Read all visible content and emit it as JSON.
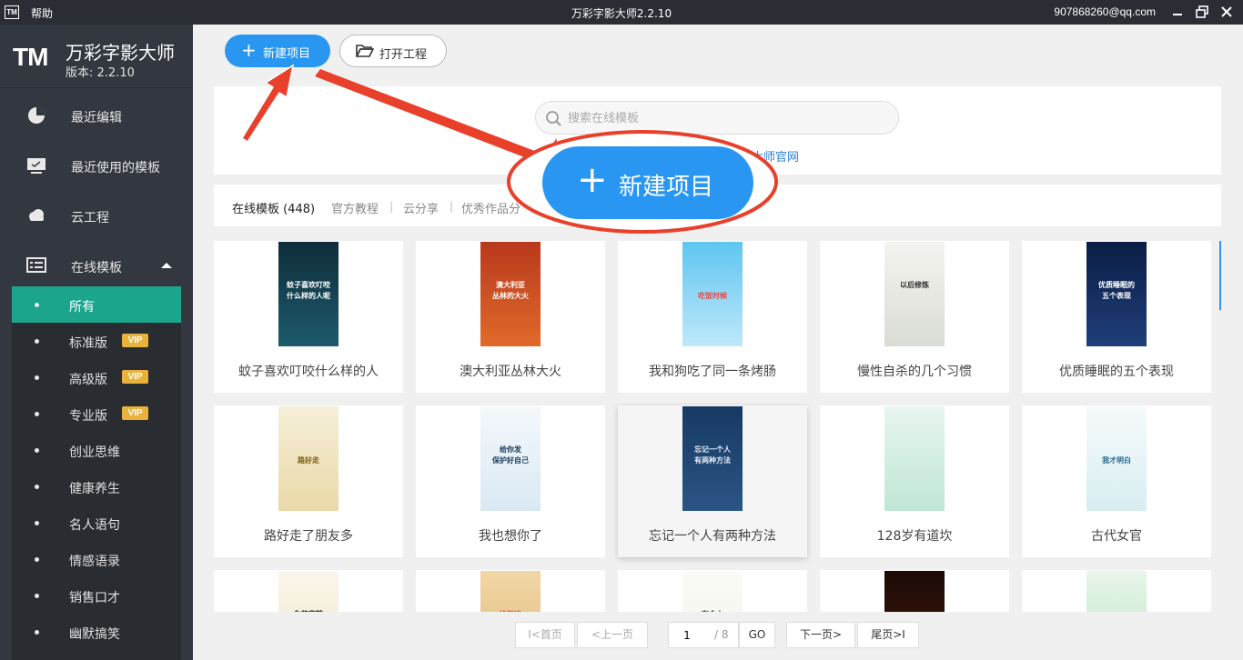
{
  "titlebar": {
    "logo": "TM",
    "help": "帮助",
    "title": "万彩字影大师2.2.10",
    "user": "907868260@qq.com"
  },
  "brand": {
    "logo": "TM",
    "name": "万彩字影大师",
    "version": "版本: 2.2.10"
  },
  "nav": {
    "recent_edit": "最近编辑",
    "recent_templates": "最近使用的模板",
    "cloud": "云工程",
    "online": "在线模板"
  },
  "subnav": [
    {
      "label": "所有",
      "vip": ""
    },
    {
      "label": "标准版",
      "vip": "VIP"
    },
    {
      "label": "高级版",
      "vip": "VIP"
    },
    {
      "label": "专业版",
      "vip": "VIP"
    },
    {
      "label": "创业思维",
      "vip": ""
    },
    {
      "label": "健康养生",
      "vip": ""
    },
    {
      "label": "名人语句",
      "vip": ""
    },
    {
      "label": "情感语录",
      "vip": ""
    },
    {
      "label": "销售口才",
      "vip": ""
    },
    {
      "label": "幽默搞笑",
      "vip": ""
    }
  ],
  "toolbar": {
    "new_project": "新建项目",
    "open_project": "打开工程"
  },
  "search": {
    "placeholder": "搜索在线模板",
    "site_link": "影大师官网"
  },
  "tabs": {
    "online": "在线模板 (448)",
    "tutorial": "官方教程",
    "share": "云分享",
    "showcase": "优秀作品分"
  },
  "cards": [
    {
      "title": "蚊子喜欢叮咬什么样的人",
      "t1": "蚊子喜欢叮咬",
      "t2": "什么样的人呢"
    },
    {
      "title": "澳大利亚丛林大火",
      "t1": "澳大利亚",
      "t2": "丛林的大火"
    },
    {
      "title": "我和狗吃了同一条烤肠",
      "t1": "",
      "t2": "吃饭时候"
    },
    {
      "title": "慢性自杀的几个习惯",
      "t1": "以后修炼",
      "t2": ""
    },
    {
      "title": "优质睡眠的五个表现",
      "t1": "优质睡眠的",
      "t2": "五个表现"
    },
    {
      "title": "路好走了朋友多",
      "t1": "",
      "t2": "路好走"
    },
    {
      "title": "我也想你了",
      "t1": "给你发",
      "t2": "保护好自己"
    },
    {
      "title": "忘记一个人有两种方法",
      "t1": "忘记一个人",
      "t2": "有两种方法"
    },
    {
      "title": "128岁有道坎",
      "t1": "",
      "t2": ""
    },
    {
      "title": "古代女官",
      "t1": "",
      "t2": "我才明白"
    },
    {
      "title": "",
      "t1": "你的容貌",
      "t2": ""
    },
    {
      "title": "",
      "t1": "冷知识",
      "t2": ""
    },
    {
      "title": "",
      "t1": "有个人",
      "t2": ""
    },
    {
      "title": "",
      "t1": "",
      "t2": ""
    },
    {
      "title": "",
      "t1": "",
      "t2": ""
    }
  ],
  "pagination": {
    "first": "I<首页",
    "prev": "<上一页",
    "current": "1",
    "total": "/ 8",
    "go": "GO",
    "next": "下一页>",
    "last": "尾页>I"
  },
  "annotation": {
    "zoom_label": "新建项目"
  },
  "colors": {
    "accent": "#2997f1",
    "active_nav": "#1aa58c",
    "sidebar": "#33373f",
    "vip": "#e9b23d",
    "arrow": "#e8402a"
  }
}
